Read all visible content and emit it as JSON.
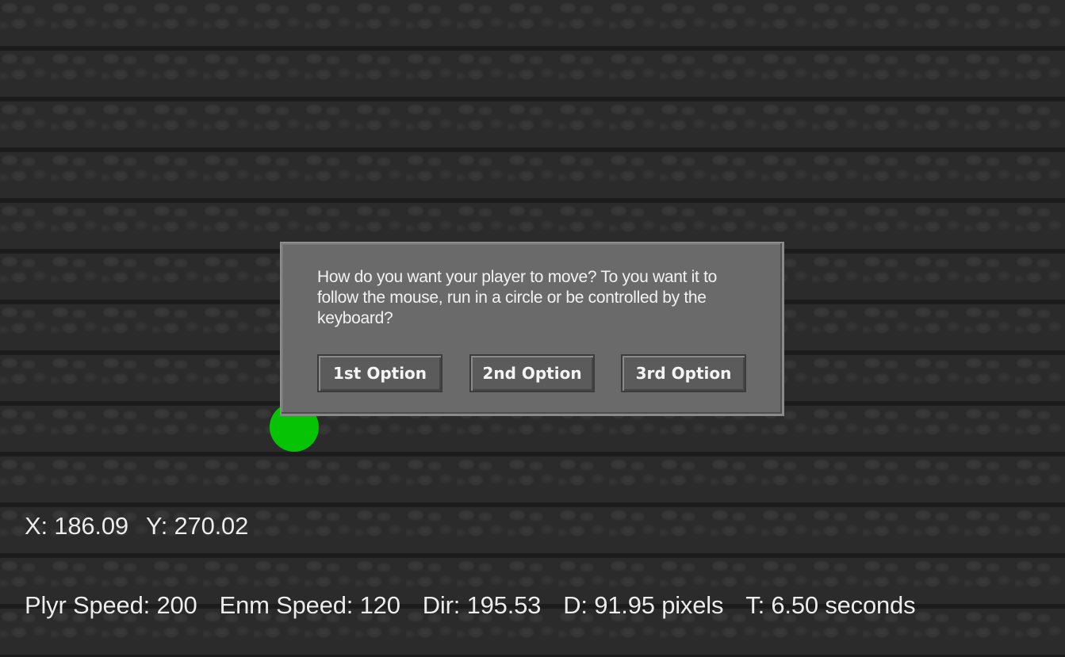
{
  "hud": {
    "coords": {
      "x": "X: 186.09",
      "y": "Y: 270.02"
    },
    "stats": {
      "player_speed": "Plyr Speed: 200",
      "enemy_speed": "Enm Speed: 120",
      "direction": "Dir: 195.53",
      "distance": "D: 91.95 pixels",
      "time": "T: 6.50 seconds"
    }
  },
  "dialog": {
    "message": "How do you want your player to move? To you want it to follow the mouse, run in a circle or be controlled by the keyboard?",
    "buttons": [
      "1st Option",
      "2nd Option",
      "3rd Option"
    ]
  },
  "colors": {
    "player": "#06c306",
    "dialog_bg": "#6a6a6a",
    "background": "#2b2b2b"
  }
}
